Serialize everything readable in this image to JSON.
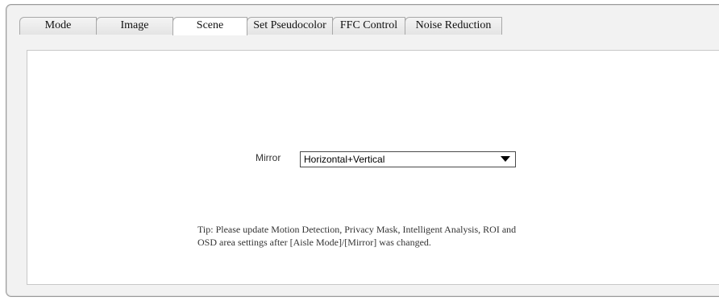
{
  "tabs": [
    {
      "label": "Mode",
      "active": false
    },
    {
      "label": "Image",
      "active": false
    },
    {
      "label": "Scene",
      "active": true
    },
    {
      "label": "Set Pseudocolor",
      "active": false
    },
    {
      "label": "FFC Control",
      "active": false
    },
    {
      "label": "Noise Reduction",
      "active": false
    }
  ],
  "scene": {
    "mirror_label": "Mirror",
    "mirror_value": "Horizontal+Vertical",
    "tip": "Tip: Please update Motion Detection, Privacy Mask, Intelligent Analysis, ROI and OSD area settings after [Aisle Mode]/[Mirror] was changed."
  },
  "colors": {
    "frame_background": "#f2f2f2",
    "panel_background": "#ffffff",
    "border": "#9a9a9a"
  }
}
